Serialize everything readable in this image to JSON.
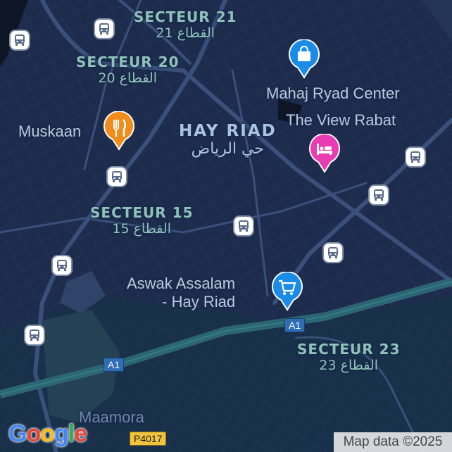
{
  "map": {
    "districts": [
      {
        "name": "SECTEUR 21",
        "arabic": "القطاع 21"
      },
      {
        "name": "SECTEUR 20",
        "arabic": "القطاع 20"
      },
      {
        "name": "SECTEUR 15",
        "arabic": "القطاع 15"
      },
      {
        "name": "SECTEUR 23",
        "arabic": "القطاع 23"
      }
    ],
    "neighborhood": {
      "name": "HAY RIAD",
      "arabic": "حي الرياض"
    },
    "places": {
      "muskaan": "Muskaan",
      "mahaj": "Mahaj Ryad Center",
      "view_rabat": "The View Rabat",
      "aswak_line1": "Aswak Assalam",
      "aswak_line2": "- Hay Riad",
      "maamora": "Maamora"
    },
    "road_shields": [
      {
        "label": "A1",
        "color": "blue"
      },
      {
        "label": "A1",
        "color": "blue"
      },
      {
        "label": "P4017",
        "color": "yellow"
      }
    ],
    "icons": {
      "restaurant": "fork-knife-icon",
      "shopping": "shopping-bag-icon",
      "hotel": "bed-icon",
      "grocery": "shopping-cart-icon",
      "transit": "bus-icon"
    },
    "colors": {
      "background": "#1d2c4d",
      "water": "#0e1626",
      "highway": "#2c6675",
      "restaurant_pin": "#f08c1b",
      "shopping_pin": "#1a8ce8",
      "hotel_pin": "#e83cb2",
      "district_label": "#8ec3b9"
    },
    "google_logo": "Google",
    "attribution": "Map data ©2025"
  }
}
